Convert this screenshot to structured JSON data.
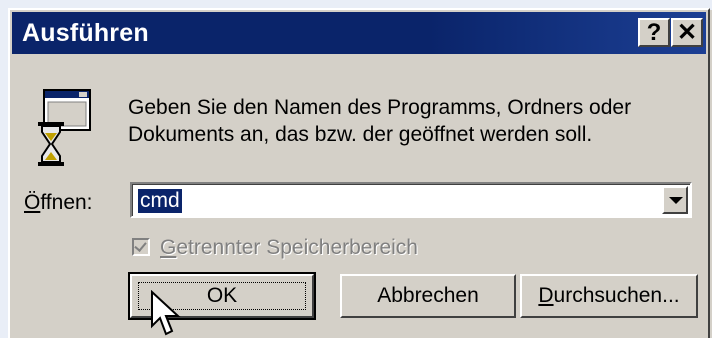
{
  "window": {
    "title": "Ausführen",
    "help_label": "?",
    "close_label": "✕"
  },
  "message": {
    "line1": "Geben Sie den Namen des Programms, Ordners oder",
    "line2": "Dokuments an, das bzw. der geöffnet werden soll."
  },
  "open_field": {
    "label_accel": "Ö",
    "label_rest": "ffnen:",
    "value": "cmd"
  },
  "separate_memory": {
    "label_accel": "G",
    "label_rest": "etrennter Speicherbereich",
    "checked": true,
    "enabled": false
  },
  "buttons": {
    "ok": "OK",
    "cancel": "Abbrechen",
    "browse_accel": "D",
    "browse_rest": "urchsuchen..."
  },
  "icons": {
    "app": "run-program-hourglass-icon",
    "cursor": "mouse-pointer-icon",
    "dropdown": "chevron-down-icon"
  }
}
